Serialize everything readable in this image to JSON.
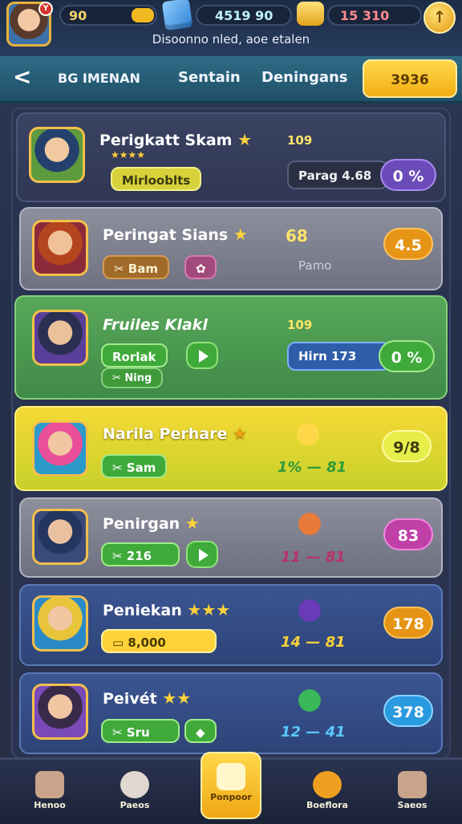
{
  "header": {
    "avatar_badge": "Y",
    "res_energy": "90",
    "res_gems": "4519 90",
    "res_tickets": "15 310",
    "coin_button": "↑",
    "subtitle": "Disoonno nled, aoe etalen"
  },
  "tabs": {
    "back": "<",
    "tab1": "BG IMENAN",
    "tab2": "Sentain",
    "tab3": "Deningans",
    "active": "3936"
  },
  "rows": [
    {
      "name": "Perigkatt Skam",
      "stars": "★",
      "sub_stars": "★★★★",
      "chip": "Mirlooblts",
      "value": "109",
      "info": "Parag 4.68",
      "pill": "0 %",
      "theme": "dark"
    },
    {
      "name": "Peringat Sians",
      "stars": "★",
      "chip": "Bam",
      "value": "68",
      "info": "Pamo",
      "pill": "4.5",
      "theme": "grey"
    },
    {
      "name": "Fruiles Klakl",
      "stars": "",
      "chip": "Rorlak",
      "chip2": "Ning",
      "value": "109",
      "info": "Hirn 173",
      "pill": "0 %",
      "theme": "green"
    },
    {
      "name": "Narila Perhare",
      "stars": "★",
      "chip": "Sam",
      "value": "1% — 81",
      "pill": "9/8",
      "theme": "yellow"
    },
    {
      "name": "Penirgan",
      "stars": "★",
      "chip": "216",
      "value": "11 — 81",
      "pill": "83",
      "theme": "grey"
    },
    {
      "name": "Peniekan",
      "stars": "★★★",
      "chip": "8,000",
      "value": "14 — 81",
      "pill": "178",
      "theme": "blue"
    },
    {
      "name": "Peivét",
      "stars": "★★",
      "chip": "Sru",
      "value": "12 — 41",
      "pill": "378",
      "theme": "blue"
    }
  ],
  "nav": [
    {
      "label": "Henoo"
    },
    {
      "label": "Paeos"
    },
    {
      "label": "Ponpoor"
    },
    {
      "label": "Boeflora"
    },
    {
      "label": "Saeos"
    }
  ],
  "colors": {
    "accent_yellow": "#f2ae14",
    "accent_green": "#3faa3a",
    "accent_purple": "#6a4bb8",
    "accent_orange": "#e69416"
  }
}
